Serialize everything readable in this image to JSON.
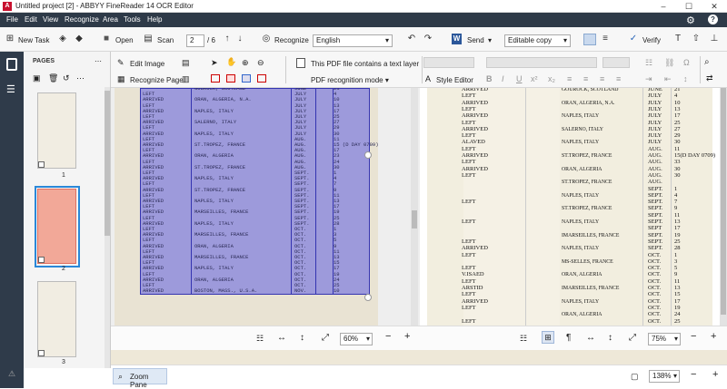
{
  "window": {
    "title": "Untitled project [2] - ABBYY FineReader 14 OCR Editor",
    "icon_text": "A",
    "min": "–",
    "max": "☐",
    "close": "✕"
  },
  "menu": [
    "File",
    "Edit",
    "View",
    "Recognize",
    "Area",
    "Tools",
    "Help"
  ],
  "toolbar": {
    "new_task": "New Task",
    "open": "Open",
    "scan": "Scan",
    "page_current": "2",
    "page_total": "/ 6",
    "recognize": "Recognize",
    "language": "English",
    "send": "Send",
    "output_format": "Editable copy",
    "verify": "Verify"
  },
  "pages_pane": {
    "title": "PAGES",
    "page_labels": [
      "1",
      "2",
      "3"
    ]
  },
  "ribbon": {
    "edit_image": "Edit Image",
    "recognize_page": "Recognize Page",
    "pdf_notice": "This PDF file contains a text layer",
    "pdf_mode": "PDF recognition mode ▾",
    "style_editor": "Style Editor"
  },
  "image_pane": {
    "zoom": "60%",
    "rows": [
      [
        "",
        "GOUROCK, SCOTLAND",
        "JUNE",
        "21"
      ],
      [
        "LEFT",
        "",
        "JULY",
        "4"
      ],
      [
        "ARRIVED",
        "ORAN, ALGERIA, N.A.",
        "JULY",
        "10"
      ],
      [
        "LEFT",
        "",
        "JULY",
        "13"
      ],
      [
        "ARRIVED",
        "NAPLES, ITALY",
        "JULY",
        "17"
      ],
      [
        "LEFT",
        "",
        "JULY",
        "25"
      ],
      [
        "ARRIVED",
        "SALERNO, ITALY",
        "JULY",
        "27"
      ],
      [
        "LEFT",
        "",
        "JULY",
        "29"
      ],
      [
        "ARRIVED",
        "NAPLES, ITALY",
        "JULY",
        "30"
      ],
      [
        "LEFT",
        "",
        "AUG.",
        "11"
      ],
      [
        "ARRIVED",
        "ST.TROPEZ, FRANCE",
        "AUG.",
        "15 (D DAY 0709)"
      ],
      [
        "LEFT",
        "",
        "AUG.",
        "17"
      ],
      [
        "ARRIVED",
        "ORAN, ALGERIA",
        "AUG.",
        "23"
      ],
      [
        "LEFT",
        "",
        "AUG.",
        "24"
      ],
      [
        "ARRIVED",
        "ST.TROPEZ, FRANCE",
        "AUG.",
        "30"
      ],
      [
        "LEFT",
        "",
        "SEPT.",
        "1"
      ],
      [
        "ARRIVED",
        "NAPLES, ITALY",
        "SEPT.",
        "4"
      ],
      [
        "LEFT",
        "",
        "SEPT.",
        "7"
      ],
      [
        "ARRIVED",
        "ST.TROPEZ, FRANCE",
        "SEPT.",
        "9"
      ],
      [
        "LEFT",
        "",
        "SEPT.",
        "11"
      ],
      [
        "ARRIVED",
        "NAPLES, ITALY",
        "SEPT.",
        "13"
      ],
      [
        "LEFT",
        "",
        "SEPT.",
        "17"
      ],
      [
        "ARRIVED",
        "MARSEILLES, FRANCE",
        "SEPT.",
        "19"
      ],
      [
        "LEFT",
        "",
        "SEPT.",
        "25"
      ],
      [
        "ARRIVED",
        "NAPLES, ITALY",
        "SEPT.",
        "28"
      ],
      [
        "LEFT",
        "",
        "OCT.",
        "1"
      ],
      [
        "ARRIVED",
        "MARSEILLES, FRANCE",
        "OCT.",
        "3"
      ],
      [
        "LEFT",
        "",
        "OCT.",
        "5"
      ],
      [
        "ARRIVED",
        "ORAN, ALGERIA",
        "OCT.",
        "9"
      ],
      [
        "LEFT",
        "",
        "OCT.",
        "11"
      ],
      [
        "ARRIVED",
        "MARSEILLES, FRANCE",
        "OCT.",
        "13"
      ],
      [
        "LEFT",
        "",
        "OCT.",
        "15"
      ],
      [
        "ARRIVED",
        "NAPLES, ITALY",
        "OCT.",
        "17"
      ],
      [
        "LEFT",
        "",
        "OCT.",
        "19"
      ],
      [
        "ARRIVED",
        "ORAN, ALGERIA",
        "OCT.",
        "24"
      ],
      [
        "LEFT",
        "",
        "OCT.",
        "25"
      ],
      [
        "ARRIVED",
        "BOSTON, MASS., U.S.A.",
        "NOV.",
        "10"
      ]
    ]
  },
  "text_pane": {
    "zoom": "75%",
    "rows": [
      [
        "ARRIVED",
        "GOUROCK, SCOTLAND",
        "JUNE",
        "21"
      ],
      [
        "LEFT",
        "",
        "JULY",
        "4"
      ],
      [
        "ARRIVED",
        "ORAN, ALGERIA, N.A.",
        "JULY",
        "10"
      ],
      [
        "LEFT",
        "",
        "JULY",
        "13"
      ],
      [
        "ARRIVED",
        "NAPLES, ITALY",
        "JULY",
        "17"
      ],
      [
        "LEFT",
        "",
        "JULY",
        "25"
      ],
      [
        "ARRIVED",
        "SALERNO, ITALY",
        "JULY",
        "27"
      ],
      [
        "LEFT",
        "",
        "JULY",
        "29"
      ],
      [
        "ALAVED",
        "NAPLES, ITALY",
        "JULY",
        "30"
      ],
      [
        "LEFT",
        "",
        "AUG.",
        "11"
      ],
      [
        "ARRIVED",
        "ST.TROPEZ, FRANCE",
        "AUG.",
        "15(D DAY 0709)"
      ],
      [
        "LEFT",
        "",
        "AUG.",
        "33"
      ],
      [
        "ARRIVED",
        "ORAN, ALGERIA",
        "AUG.",
        "30"
      ],
      [
        "LEFT",
        "",
        "AUG.",
        "30"
      ],
      [
        "",
        "ST.TROPEZ, FRANCE",
        "AUG.",
        ""
      ],
      [
        "",
        "",
        "SEPT.",
        "1"
      ],
      [
        "",
        "NAPLES, ITALY",
        "SEPT.",
        "4"
      ],
      [
        "LEFT",
        "",
        "SEPT.",
        "7"
      ],
      [
        "",
        "ST.TROPEZ, FRANCE",
        "SEPT.",
        "9"
      ],
      [
        "",
        "",
        "SEPT.",
        "11"
      ],
      [
        "LEFT",
        "NAPLES, ITALY",
        "SEPT.",
        "13"
      ],
      [
        "",
        "",
        "SEPT",
        "17"
      ],
      [
        "",
        "IMARSEILLES, FRANCE",
        "SEPT.",
        "19"
      ],
      [
        "LEFT",
        "",
        "SEPT.",
        "25"
      ],
      [
        "ARRIVED",
        "NAPLES, ITALY",
        "SEPT.",
        "28"
      ],
      [
        "LEFT",
        "",
        "OCT.",
        "1"
      ],
      [
        "",
        "MS-SELLES, FRANCE",
        "OCT.",
        "3"
      ],
      [
        "LEFT",
        "",
        "OCT.",
        "5"
      ],
      [
        "V.ISAED",
        "ORAN, ALGERIA",
        "OCT.",
        "9"
      ],
      [
        "LEFT",
        "",
        "OCT.",
        "11"
      ],
      [
        "ARSTID",
        "IMARSEILLES, FRANCE",
        "OCT.",
        "13"
      ],
      [
        "LEFT",
        "",
        "OCT.",
        "15"
      ],
      [
        "ARRIVED",
        "NAPLES, ITALY",
        "OCT.",
        "17"
      ],
      [
        "LEFT",
        "",
        "OCT.",
        "19"
      ],
      [
        "",
        "ORAN, ALGERIA",
        "OCT.",
        "24"
      ],
      [
        "LEFT",
        "",
        "OCT.",
        "25"
      ]
    ]
  },
  "zoom_pane": {
    "label": "Zoom Pane",
    "zoom": "138%"
  },
  "colors": {
    "menubar": "#2e3a48",
    "selection_blue": "#5a5ad8",
    "thumb_selected": "#f2a898"
  }
}
